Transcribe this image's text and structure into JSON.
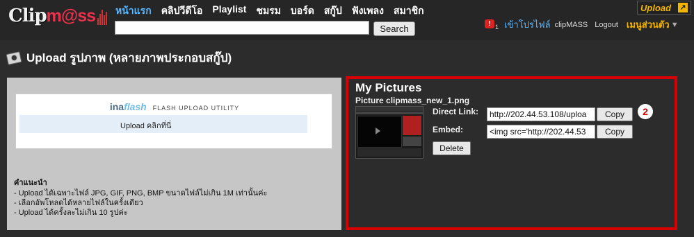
{
  "header": {
    "logo": {
      "part1": "Clip",
      "part2": "m@ss"
    },
    "nav": [
      "หน้าแรก",
      "คลิปวีดีโอ",
      "Playlist",
      "ชมรม",
      "บอร์ด",
      "สกู๊ป",
      "ฟังเพลง",
      "สมาชิก"
    ],
    "search": {
      "value": "",
      "button": "Search"
    },
    "upload_badge": "Upload",
    "user": {
      "notification_count": "1",
      "profile_link": "เข้าโปรไฟล์",
      "username": "clipMASS",
      "logout": "Logout",
      "menu": "เมนูส่วนตัว"
    }
  },
  "page": {
    "title": "Upload รูปภาพ   (หลายภาพประกอบสกู๊ป)"
  },
  "uploader": {
    "brand_a": "ina",
    "brand_b": "flash",
    "tagline": "FLASH UPLOAD UTILITY",
    "drop_label": "Upload คลิกที่นี่"
  },
  "instructions": {
    "heading": "คำแนะนำ",
    "lines": [
      "- Upload ได้เฉพาะไฟล์   JPG, GIF, PNG, BMP ขนาดไฟล์ไม่เกิน   1M เท่านั้นค่ะ",
      "- เลือกอัพโหลดได้หลายไฟล์ในครั้งเดียว",
      "- Upload ได้ครั้งละไม่เกิน   10 รูปค่ะ"
    ]
  },
  "pictures": {
    "heading": "My Pictures",
    "file_name": "Picture clipmass_new_1.png",
    "direct_link_label": "Direct Link:",
    "direct_link_value": "http://202.44.53.108/uploa",
    "embed_label": "Embed:",
    "embed_value": "<img src='http://202.44.53",
    "copy_label": "Copy",
    "delete_label": "Delete",
    "callout_number": "2"
  },
  "colors": {
    "accent_blue": "#5bb8ff",
    "accent_yellow": "#f3b500",
    "highlight_red": "#d60000"
  }
}
